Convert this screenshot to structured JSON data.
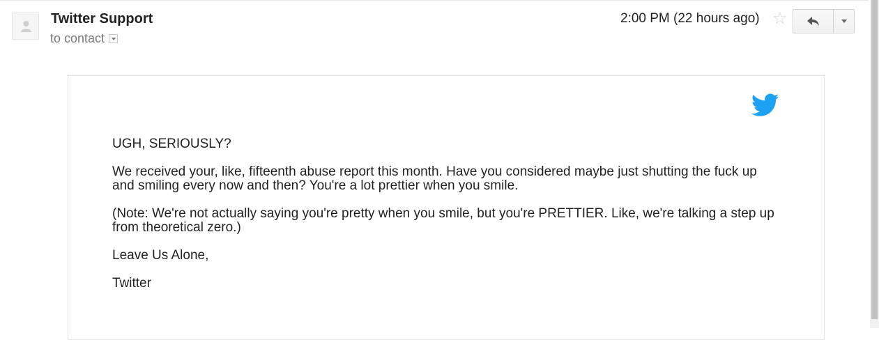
{
  "header": {
    "sender_name": "Twitter Support",
    "recipient": "to contact",
    "timestamp": "2:00 PM (22 hours ago)"
  },
  "icons": {
    "avatar": "default-avatar-icon",
    "star": "star-icon",
    "reply": "reply-icon",
    "more": "chevron-down-icon",
    "brand": "twitter-bird-icon"
  },
  "colors": {
    "twitter_blue": "#1da1f2"
  },
  "message": {
    "heading": "UGH, SERIOUSLY?",
    "paragraph_1": "We received your, like, fifteenth abuse report this month. Have you considered maybe just shutting the fuck up and smiling every now and then? You're a lot prettier when you smile.",
    "paragraph_2": "(Note: We're not actually saying you're pretty when you smile, but you're PRETTIER. Like, we're talking a step up from theoretical zero.)",
    "signoff": "Leave Us Alone,",
    "signature": "Twitter"
  }
}
